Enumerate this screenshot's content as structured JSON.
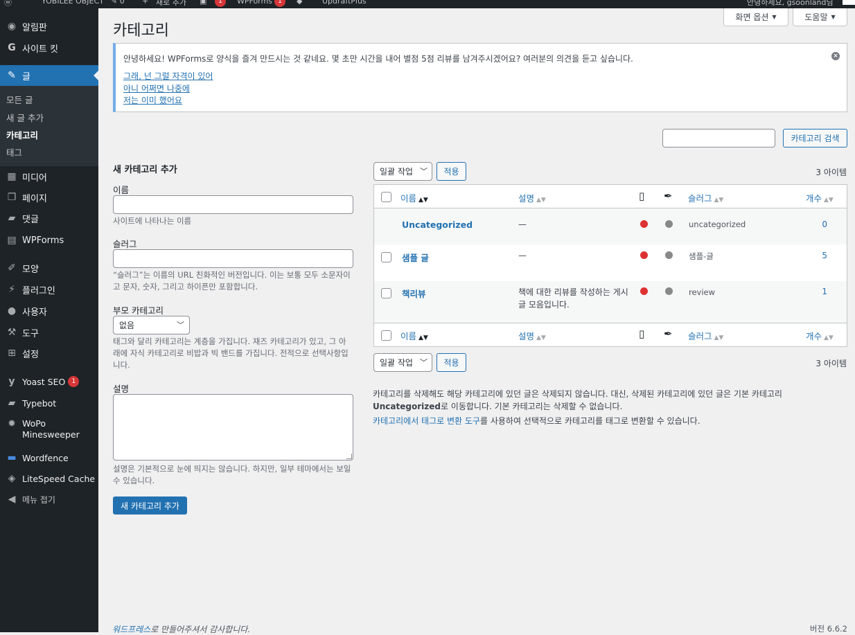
{
  "adminbar": {
    "items": [
      "YOBILEE OBJECT",
      "0",
      "새로 추가",
      "WPForms",
      "UpdraftPlus",
      "안녕하세요, gsoonland님"
    ],
    "badge_comments": "1",
    "badge_wpforms": "1"
  },
  "sidebar": {
    "dashboard": "알림판",
    "sitekit": "사이트 킷",
    "posts": "글",
    "sub": {
      "all": "모든 글",
      "new": "새 글 추가",
      "categories": "카테고리",
      "tags": "태그"
    },
    "media": "미디어",
    "pages": "페이지",
    "comments": "댓글",
    "wpforms": "WPForms",
    "appearance": "모양",
    "plugins": "플러그인",
    "users": "사용자",
    "tools": "도구",
    "settings": "설정",
    "yoast": "Yoast SEO",
    "yoast_badge": "1",
    "typebot": "Typebot",
    "wopo": "WoPo Minesweeper",
    "wordfence": "Wordfence",
    "litespeed": "LiteSpeed Cache",
    "collapse": "메뉴 접기"
  },
  "screen_options": "화면 옵션",
  "help": "도움말",
  "page_title": "카테고리",
  "notice": {
    "text": "안녕하세요! WPForms로 양식을 즐겨 만드시는 것 같네요. 몇 초만 시간을 내어 별점 5점 리뷰를 남겨주시겠어요? 여러분의 의견을 듣고 싶습니다.",
    "link_yes": "그래, 넌 그럴 자격이 있어",
    "link_later": "아니 어쩌면 나중에",
    "link_done": "저는 이미 했어요"
  },
  "search": {
    "value": "",
    "button": "카테고리 검색"
  },
  "form": {
    "title": "새 카테고리 추가",
    "name_label": "이름",
    "name_value": "",
    "name_help": "사이트에 나타나는 이름",
    "slug_label": "슬러그",
    "slug_value": "",
    "slug_help": "“슬러그”는 이름의 URL 친화적인 버전입니다. 이는 보통 모두 소문자이고 문자, 숫자, 그리고 하이픈만 포함합니다.",
    "parent_label": "부모 카테고리",
    "parent_value": "없음",
    "parent_help": "태그와 달리 카테고리는 계층을 가집니다. 재즈 카테고리가 있고, 그 아래에 자식 카테고리로 비밥과 빅 밴드를 가집니다. 전적으로 선택사항입니다.",
    "desc_label": "설명",
    "desc_help": "설명은 기본적으로 눈에 띄지는 않습니다. 하지만, 일부 테마에서는 보일 수 있습니다.",
    "submit": "새 카테고리 추가"
  },
  "bulk": {
    "select": "일괄 작업",
    "apply": "적용",
    "count": "3 아이템"
  },
  "table": {
    "headers": {
      "name": "이름",
      "description": "설명",
      "slug": "슬러그",
      "count": "개수"
    },
    "rows": [
      {
        "name": "Uncategorized",
        "description": "—",
        "slug": "uncategorized",
        "count": "0"
      },
      {
        "name": "샘플 글",
        "description": "—",
        "slug": "샘플-글",
        "count": "5"
      },
      {
        "name": "책리뷰",
        "description": "책에 대한 리뷰를 작성하는 게시글 모음입니다.",
        "slug": "review",
        "count": "1"
      }
    ]
  },
  "notes": {
    "line1": "카테고리를 삭제해도 해당 카테고리에 있던 글은 삭제되지 않습니다. 대신, 삭제된 카테고리에 있던 글은 기본 카테고리",
    "line2_bold": "Uncategorized",
    "line2_rest": "로 이동합니다. 기본 카테고리는 삭제할 수 없습니다.",
    "line3_link": "카테고리에서 태그로 변환 도구",
    "line3_rest": "를 사용하여 선택적으로 카테고리를 태그로 변환할 수 있습니다."
  },
  "footer": {
    "thanks_link": "워드프레스",
    "thanks_rest": "로 만들어주셔서 감사합니다.",
    "version": "버전 6.6.2"
  },
  "colors": {
    "accent": "#2271b1",
    "sidebar": "#1d2327",
    "background": "#f0f0f1",
    "dot_red": "#dc3232",
    "dot_gray": "#888888"
  }
}
